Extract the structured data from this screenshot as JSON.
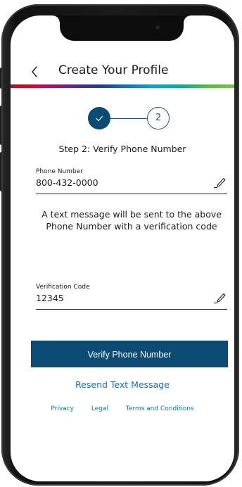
{
  "header": {
    "title": "Create Your Profile"
  },
  "stepper": {
    "step_two_number": "2",
    "current_step_title": "Step 2: Verify Phone Number"
  },
  "phone_field": {
    "label": "Phone Number",
    "value": "800-432-0000"
  },
  "info": {
    "message": "A text message will be sent to the above Phone Number with a verification code"
  },
  "code_field": {
    "label": "Verification Code",
    "value": "12345"
  },
  "actions": {
    "verify_label": "Verify Phone Number",
    "resend_label": "Resend Text Message"
  },
  "footer": {
    "links": [
      "Privacy",
      "Legal",
      "Terms and Conditions"
    ]
  },
  "colors": {
    "primary": "#0b4a73",
    "link": "#1b6fa8",
    "text": "#1b1b1b"
  },
  "icons": {
    "back": "chevron-left-icon",
    "step_done": "check-icon",
    "edit": "pencil-icon"
  }
}
